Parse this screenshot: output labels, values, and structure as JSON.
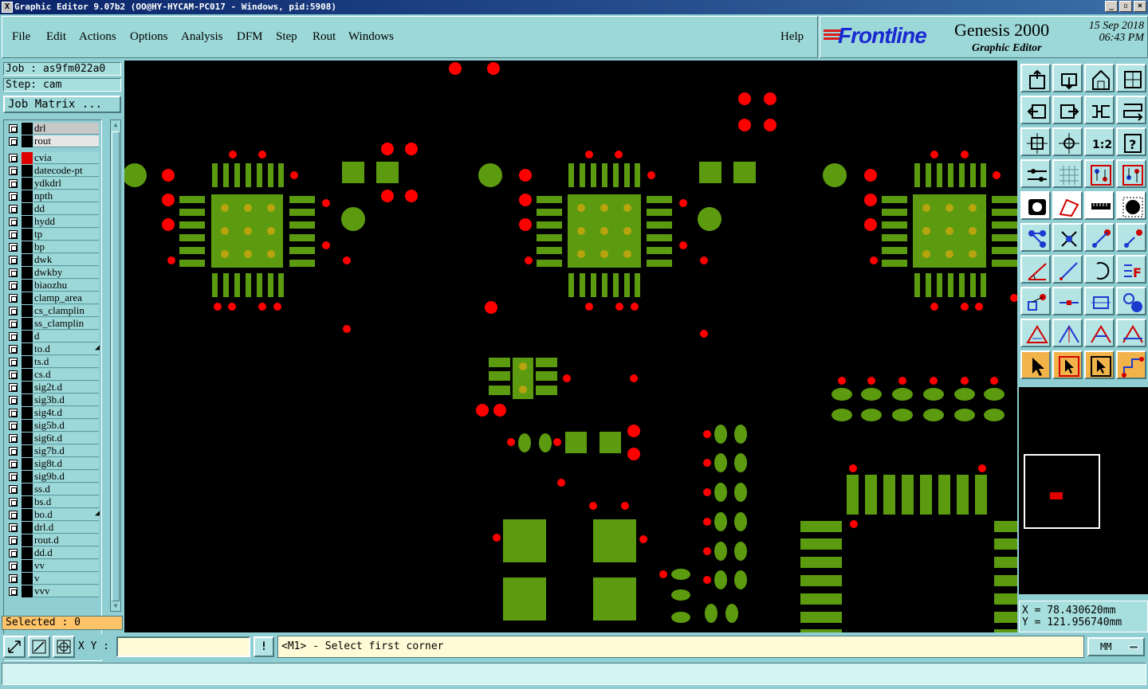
{
  "window": {
    "title": "Graphic Editor 9.07b2 (OO@HY-HYCAM-PC017 - Windows, pid:5908)",
    "controls": [
      "_",
      "▫",
      "×"
    ]
  },
  "menu": {
    "items": [
      "File",
      "Edit",
      "Actions",
      "Options",
      "Analysis",
      "DFM",
      "Step",
      "Rout",
      "Windows"
    ],
    "help": "Help"
  },
  "brand": {
    "logo": "Frontline",
    "product": "Genesis 2000",
    "subtitle": "Graphic Editor",
    "date": "15 Sep 2018",
    "time": "06:43 PM"
  },
  "job": {
    "job_label": "Job : as9fm022a0",
    "step_label": "Step: cam",
    "matrix_button": "Job Matrix ..."
  },
  "layers": [
    {
      "name": "drl",
      "style": "grey"
    },
    {
      "name": "rout",
      "style": "plain-light"
    },
    {
      "name": "cvia",
      "style": "active"
    },
    {
      "name": "datecode-pt",
      "style": ""
    },
    {
      "name": "ydkdrl",
      "style": ""
    },
    {
      "name": "npth",
      "style": ""
    },
    {
      "name": "dd",
      "style": ""
    },
    {
      "name": "hydd",
      "style": ""
    },
    {
      "name": "tp",
      "style": ""
    },
    {
      "name": "bp",
      "style": ""
    },
    {
      "name": "dwk",
      "style": ""
    },
    {
      "name": "dwkby",
      "style": ""
    },
    {
      "name": "biaozhu",
      "style": ""
    },
    {
      "name": "clamp_area",
      "style": ""
    },
    {
      "name": "cs_clamplin",
      "style": ""
    },
    {
      "name": "ss_clamplin",
      "style": ""
    },
    {
      "name": "d",
      "style": ""
    },
    {
      "name": "to.d",
      "style": "mark"
    },
    {
      "name": "ts.d",
      "style": ""
    },
    {
      "name": "cs.d",
      "style": ""
    },
    {
      "name": "sig2t.d",
      "style": ""
    },
    {
      "name": "sig3b.d",
      "style": ""
    },
    {
      "name": "sig4t.d",
      "style": ""
    },
    {
      "name": "sig5b.d",
      "style": ""
    },
    {
      "name": "sig6t.d",
      "style": ""
    },
    {
      "name": "sig7b.d",
      "style": ""
    },
    {
      "name": "sig8t.d",
      "style": ""
    },
    {
      "name": "sig9b.d",
      "style": ""
    },
    {
      "name": "ss.d",
      "style": ""
    },
    {
      "name": "bs.d",
      "style": ""
    },
    {
      "name": "bo.d",
      "style": "mark"
    },
    {
      "name": "drl.d",
      "style": ""
    },
    {
      "name": "rout.d",
      "style": ""
    },
    {
      "name": "dd.d",
      "style": ""
    },
    {
      "name": "vv",
      "style": ""
    },
    {
      "name": "v",
      "style": ""
    },
    {
      "name": "vvv",
      "style": ""
    }
  ],
  "selection": {
    "label": "Selected : 0"
  },
  "coordinates": {
    "x": "X = 78.430620mm",
    "y": "Y = 121.956740mm"
  },
  "bottom": {
    "xy_label": "X Y :",
    "xy_value": "",
    "info_button": "!",
    "prompt": "<M1> - Select first corner",
    "units": "MM"
  },
  "colors": {
    "pad": "#5c9b0f",
    "pad_center": "#b8a40f",
    "drill": "#ff0000",
    "canvas_bg": "#000000",
    "panel_bg": "#8fcfd3"
  },
  "tool_icons": [
    "zoom-home-icon",
    "zoom-in-area-icon",
    "zoom-window-icon",
    "zoom-out-icon",
    "pan-left-icon",
    "pan-right-icon",
    "zoom-previous-icon",
    "redraw-icon",
    "fit-view-icon",
    "center-icon",
    "scale-1-2-icon",
    "help-query-icon",
    "snap-settings-icon",
    "grid-icon",
    "layer-display-icon",
    "layer-display-alt-icon",
    "feature-info-icon",
    "measure-polygon-icon",
    "ruler-icon",
    "pad-feature-icon",
    "net-connect-icon",
    "cross-probe-icon",
    "line-measure-icon",
    "pin-measure-icon",
    "angle-line-icon",
    "draw-line-icon",
    "arc-icon",
    "text-attrib-icon",
    "pad-to-pad-icon",
    "horizontal-measure-icon",
    "component-icon",
    "multi-pad-icon",
    "triangle-measure-icon",
    "triangle-angle-icon",
    "triangle-height-icon",
    "triangle-span-icon",
    "select-pointer-icon",
    "select-box-icon",
    "select-touch-icon",
    "select-net-icon"
  ]
}
